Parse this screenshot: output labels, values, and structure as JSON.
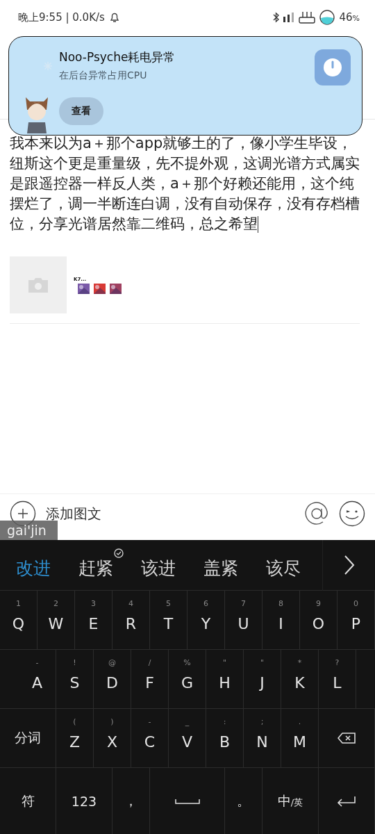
{
  "status_bar": {
    "time": "晚上9:55 | 0.0K/s",
    "battery": "46",
    "battery_unit": "%"
  },
  "notification": {
    "title": "Noo-Psyche耗电异常",
    "subtitle": "在后台异常占用CPU",
    "action": "查看"
  },
  "post": {
    "text": "我本来以为a＋那个app就够土的了，像小学生毕设，纽斯这个更是重量级，先不提外观，这调光谱方式属实是跟遥控器一样反人类，a＋那个好赖还能用，这个纯摆烂了，调一半断连白调，没有自动保存，没有存档槽位，分享光谱居然靠二维码，总之希望",
    "attachment_label": "K7..."
  },
  "toolbar": {
    "add_label": "添加图文",
    "composing": "gai'jin"
  },
  "candidates": [
    {
      "text": "改进",
      "selected": true,
      "learned": false
    },
    {
      "text": "赶紧",
      "selected": false,
      "learned": true
    },
    {
      "text": "该进",
      "selected": false,
      "learned": false
    },
    {
      "text": "盖紧",
      "selected": false,
      "learned": false
    },
    {
      "text": "该尽",
      "selected": false,
      "learned": false
    }
  ],
  "keyboard_rows": [
    [
      {
        "kind": "letter",
        "label": "Q",
        "hint": "1"
      },
      {
        "kind": "letter",
        "label": "W",
        "hint": "2"
      },
      {
        "kind": "letter",
        "label": "E",
        "hint": "3"
      },
      {
        "kind": "letter",
        "label": "R",
        "hint": "4"
      },
      {
        "kind": "letter",
        "label": "T",
        "hint": "5"
      },
      {
        "kind": "letter",
        "label": "Y",
        "hint": "6"
      },
      {
        "kind": "letter",
        "label": "U",
        "hint": "7"
      },
      {
        "kind": "letter",
        "label": "I",
        "hint": "8"
      },
      {
        "kind": "letter",
        "label": "O",
        "hint": "9"
      },
      {
        "kind": "letter",
        "label": "P",
        "hint": "0"
      }
    ],
    [
      {
        "kind": "letter",
        "label": "A",
        "hint": "-"
      },
      {
        "kind": "letter",
        "label": "S",
        "hint": "!"
      },
      {
        "kind": "letter",
        "label": "D",
        "hint": "@"
      },
      {
        "kind": "letter",
        "label": "F",
        "hint": "/"
      },
      {
        "kind": "letter",
        "label": "G",
        "hint": "%"
      },
      {
        "kind": "letter",
        "label": "H",
        "hint": "\""
      },
      {
        "kind": "letter",
        "label": "J",
        "hint": "\""
      },
      {
        "kind": "letter",
        "label": "K",
        "hint": "*"
      },
      {
        "kind": "letter",
        "label": "L",
        "hint": "?"
      }
    ],
    [
      {
        "kind": "function",
        "label": "分词"
      },
      {
        "kind": "letter",
        "label": "Z",
        "hint": "("
      },
      {
        "kind": "letter",
        "label": "X",
        "hint": ")"
      },
      {
        "kind": "letter",
        "label": "C",
        "hint": "-"
      },
      {
        "kind": "letter",
        "label": "V",
        "hint": "_"
      },
      {
        "kind": "letter",
        "label": "B",
        "hint": ":"
      },
      {
        "kind": "letter",
        "label": "N",
        "hint": ";"
      },
      {
        "kind": "letter",
        "label": "M",
        "hint": "."
      },
      {
        "kind": "backspace"
      }
    ],
    [
      {
        "kind": "function",
        "label": "符"
      },
      {
        "kind": "function",
        "label": "123"
      },
      {
        "kind": "punct",
        "label": "，"
      },
      {
        "kind": "space"
      },
      {
        "kind": "punct",
        "label": "。"
      },
      {
        "kind": "lang",
        "label": "中",
        "sub": "/英"
      },
      {
        "kind": "enter"
      }
    ]
  ]
}
